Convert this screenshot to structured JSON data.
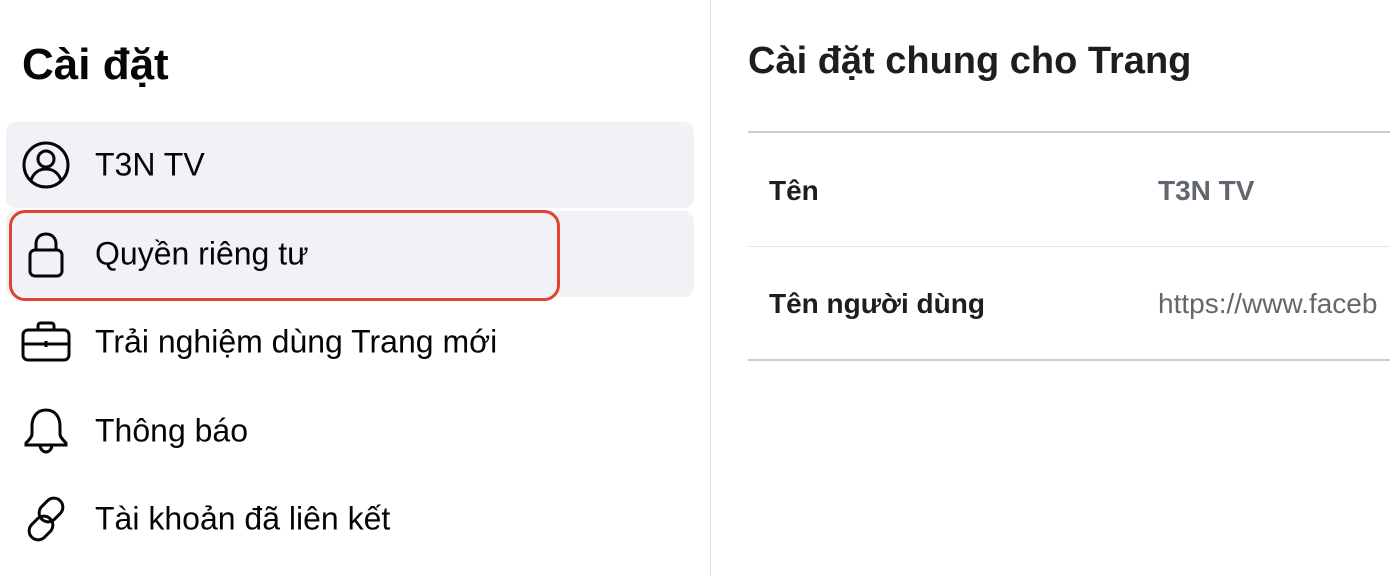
{
  "sidebar": {
    "title": "Cài đặt",
    "items": [
      {
        "label": "T3N TV",
        "icon": "profile-icon"
      },
      {
        "label": "Quyền riêng tư",
        "icon": "lock-icon"
      },
      {
        "label": "Trải nghiệm dùng Trang mới",
        "icon": "briefcase-icon"
      },
      {
        "label": "Thông báo",
        "icon": "bell-icon"
      },
      {
        "label": "Tài khoản đã liên kết",
        "icon": "link-icon"
      }
    ]
  },
  "main": {
    "title": "Cài đặt chung cho Trang",
    "rows": [
      {
        "label": "Tên",
        "value": "T3N TV"
      },
      {
        "label": "Tên người dùng",
        "value": "https://www.faceb"
      }
    ]
  },
  "colors": {
    "highlight": "#e0432f",
    "selected_bg": "#f0f2f5"
  }
}
